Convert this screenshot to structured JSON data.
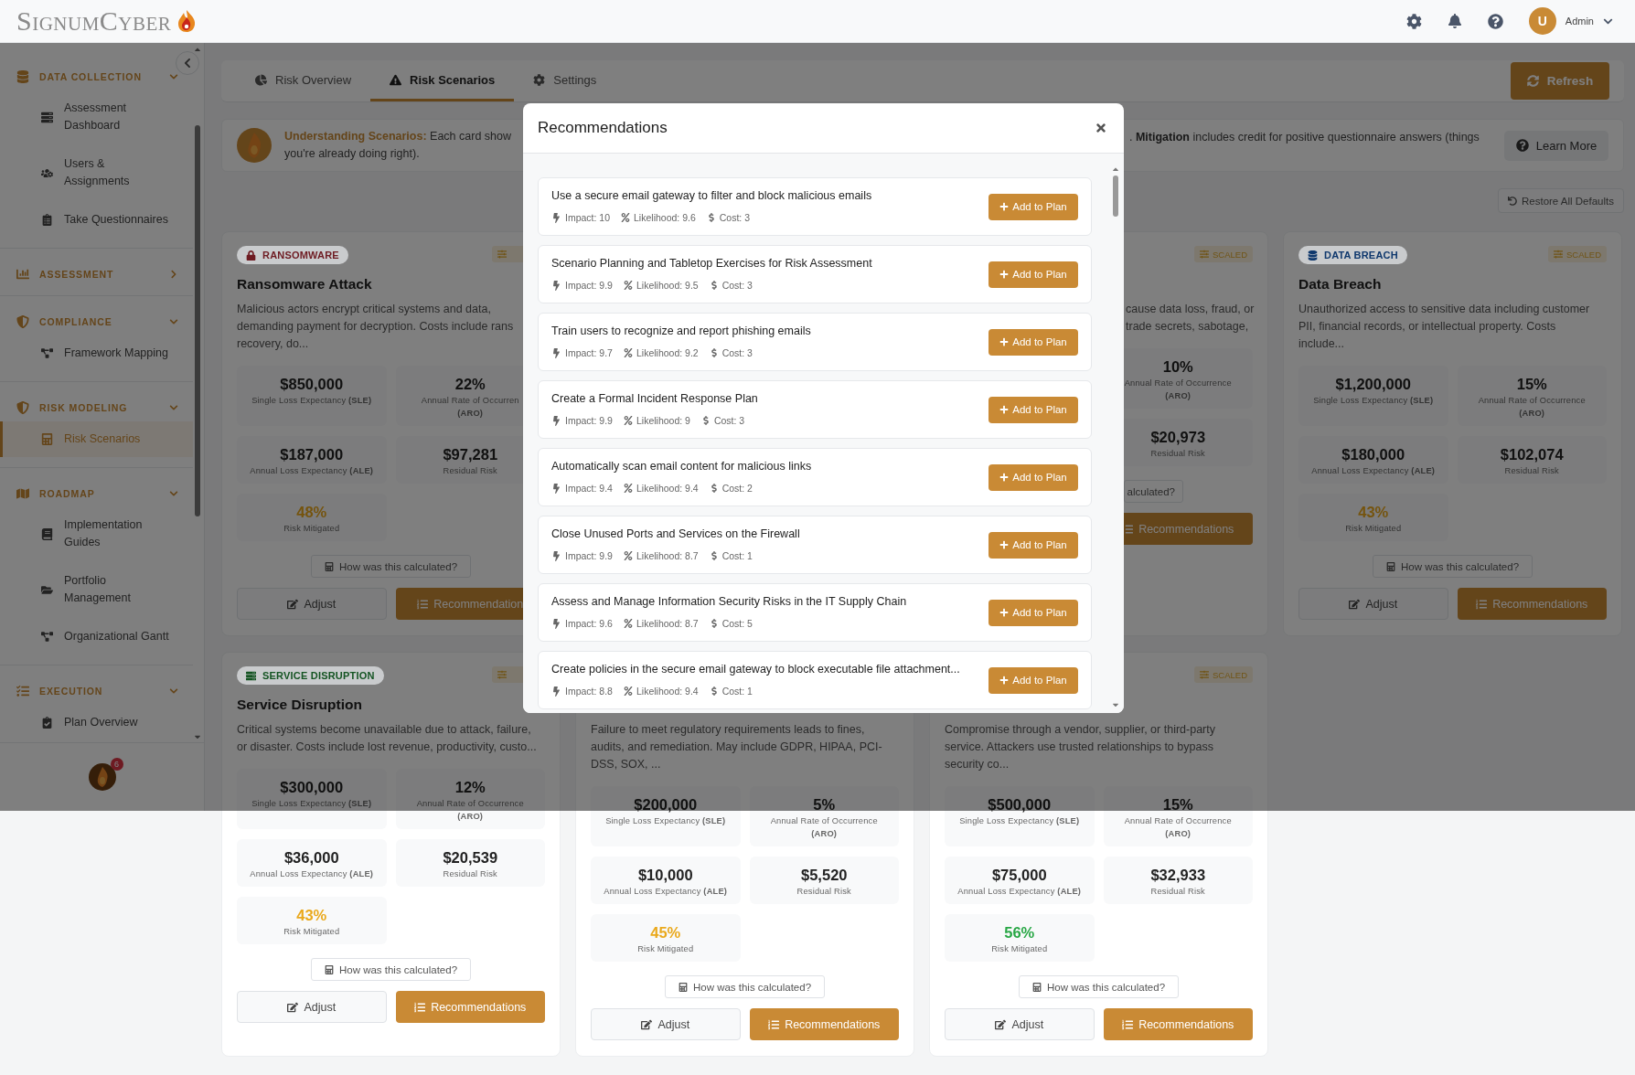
{
  "header": {
    "logo": "SignumCyber",
    "user_initial": "U",
    "user_name": "Admin"
  },
  "sidebar": {
    "sections": [
      {
        "title": "DATA COLLECTION",
        "expanded": true,
        "items": [
          {
            "label": "Assessment Dashboard",
            "selected": false
          },
          {
            "label": "Users & Assignments",
            "selected": false
          },
          {
            "label": "Take Questionnaires",
            "selected": false
          }
        ]
      },
      {
        "title": "ASSESSMENT",
        "expanded": false
      },
      {
        "title": "COMPLIANCE",
        "expanded": true,
        "items": [
          {
            "label": "Framework Mapping",
            "selected": false
          }
        ]
      },
      {
        "title": "RISK MODELING",
        "expanded": true,
        "items": [
          {
            "label": "Risk Scenarios",
            "selected": true
          }
        ]
      },
      {
        "title": "ROADMAP",
        "expanded": true,
        "items": [
          {
            "label": "Implementation Guides",
            "selected": false
          },
          {
            "label": "Portfolio Management",
            "selected": false
          },
          {
            "label": "Organizational Gantt",
            "selected": false
          }
        ]
      },
      {
        "title": "EXECUTION",
        "expanded": true,
        "items": [
          {
            "label": "Plan Overview",
            "selected": false
          }
        ]
      }
    ],
    "notification_count": "6"
  },
  "tabs": [
    {
      "label": "Risk Overview",
      "selected": false
    },
    {
      "label": "Risk Scenarios",
      "selected": true
    },
    {
      "label": "Settings",
      "selected": false
    }
  ],
  "refresh_label": "Refresh",
  "banner": {
    "left_lines": [
      "**Understanding Scenarios:** Each card show",
      "you're already doing right)."
    ],
    "right_text": ". **Mitigation** includes credit for positive questionnaire answers (things",
    "button": "Learn More"
  },
  "restore_label": "Restore All Defaults",
  "cards": [
    {
      "kind": "full",
      "tag": {
        "label": "RANSOMWARE",
        "color": "#6e1b22"
      },
      "scaled": true,
      "title": "Ransomware Attack",
      "desc_lines": [
        "Malicious actors encrypt critical systems and data,",
        "demanding payment for decryption. Costs include rans",
        "recovery, do..."
      ],
      "stats": [
        {
          "value": "$850,000",
          "lines": [
            "Single Loss Expectancy **(SLE)**"
          ]
        },
        {
          "value": "22%",
          "lines": [
            "Annual Rate of Occurren",
            "**(ARO)**"
          ]
        },
        {
          "value": "$187,000",
          "lines": [
            "Annual Loss Expectancy **(ALE)**"
          ]
        },
        {
          "value": "$97,281",
          "lines": [
            "Residual Risk"
          ]
        }
      ],
      "mitigated": {
        "value": "48%",
        "label": "Risk Mitigated",
        "color": "#75540e"
      },
      "calc": "How was this calculated?",
      "adjust": "Adjust",
      "recommend": "Recommendation"
    },
    {
      "kind": "covered"
    },
    {
      "kind": "right_part",
      "scaled": true,
      "scaled_label": "SCALED",
      "desc_lines": [
        "cause data loss, fraud, or",
        "trade secrets, sabotage,"
      ],
      "stats": [
        {
          "value": "10%",
          "lines": [
            "Annual Rate of Occurrence",
            "**(ARO)**"
          ]
        },
        {
          "value": "$20,973",
          "lines": [
            "Residual Risk"
          ]
        }
      ],
      "calc": "alculated?",
      "recommend": "Recommendations"
    },
    {
      "kind": "full",
      "tag": {
        "label": "DATA BREACH",
        "color": "#0f386d"
      },
      "scaled": true,
      "scaled_label": "SCALED",
      "title": "Data Breach",
      "desc_lines": [
        "Unauthorized access to sensitive data including customer",
        "PII, financial records, or intellectual property. Costs",
        "include..."
      ],
      "stats": [
        {
          "value": "$1,200,000",
          "lines": [
            "Single Loss Expectancy **(SLE)**"
          ]
        },
        {
          "value": "15%",
          "lines": [
            "Annual Rate of Occurrence",
            "**(ARO)**"
          ]
        },
        {
          "value": "$180,000",
          "lines": [
            "Annual Loss Expectancy **(ALE)**"
          ]
        },
        {
          "value": "$102,074",
          "lines": [
            "Residual Risk"
          ]
        }
      ],
      "mitigated": {
        "value": "43%",
        "label": "Risk Mitigated",
        "color": "#75540e"
      },
      "calc": "How was this calculated?",
      "adjust": "Adjust",
      "recommend": "Recommendations"
    },
    {
      "kind": "full",
      "tag": {
        "label": "SERVICE DISRUPTION",
        "color": "#145422"
      },
      "scaled": true,
      "title": "Service Disruption",
      "desc_lines": [
        "Critical systems become unavailable due to attack, failure,",
        "or disaster. Costs include lost revenue, productivity, custo..."
      ],
      "stats": [
        {
          "value": "$300,000",
          "lines": [
            "Single Loss Expectancy **(SLE)**"
          ]
        },
        {
          "value": "12%",
          "lines": [
            "Annual Rate of Occurrence",
            "**(ARO)**"
          ]
        },
        {
          "value": "$36,000",
          "lines": [
            "Annual Loss Expectancy **(ALE)**"
          ]
        },
        {
          "value": "$20,539",
          "lines": [
            "Residual Risk"
          ]
        }
      ],
      "mitigated": {
        "value": "43%",
        "label": "Risk Mitigated",
        "color": "#eaa91c"
      },
      "calc": "How was this calculated?",
      "adjust": "Adjust",
      "recommend": "Recommendations"
    },
    {
      "kind": "full",
      "desc_lines": [
        "Failure to meet regulatory requirements leads to fines,",
        "audits, and remediation. May include GDPR, HIPAA, PCI-",
        "DSS, SOX, ..."
      ],
      "stats": [
        {
          "value": "$200,000",
          "lines": [
            "Single Loss Expectancy **(SLE)**"
          ]
        },
        {
          "value": "5%",
          "lines": [
            "Annual Rate of Occurrence",
            "**(ARO)**"
          ]
        },
        {
          "value": "$10,000",
          "lines": [
            "Annual Loss Expectancy **(ALE)**"
          ]
        },
        {
          "value": "$5,520",
          "lines": [
            "Residual Risk"
          ]
        }
      ],
      "mitigated": {
        "value": "45%",
        "label": "Risk Mitigated",
        "color": "#eaa91c"
      },
      "calc": "How was this calculated?",
      "adjust": "Adjust",
      "recommend": "Recommendations"
    },
    {
      "kind": "full",
      "scaled": true,
      "scaled_label": "SCALED",
      "desc_lines": [
        "Compromise through a vendor, supplier, or third-party",
        "service. Attackers use trusted relationships to bypass",
        "security co..."
      ],
      "stats": [
        {
          "value": "$500,000",
          "lines": [
            "Single Loss Expectancy **(SLE)**"
          ]
        },
        {
          "value": "15%",
          "lines": [
            "Annual Rate of Occurrence",
            "**(ARO)**"
          ]
        },
        {
          "value": "$75,000",
          "lines": [
            "Annual Loss Expectancy **(ALE)**"
          ]
        },
        {
          "value": "$32,933",
          "lines": [
            "Residual Risk"
          ]
        }
      ],
      "mitigated": {
        "value": "56%",
        "label": "Risk Mitigated",
        "color": "#28a745"
      },
      "calc": "How was this calculated?",
      "adjust": "Adjust",
      "recommend": "Recommendations"
    }
  ],
  "modal": {
    "title": "Recommendations",
    "items": [
      {
        "title": "Use a secure email gateway to filter and block malicious emails",
        "impact": "Impact: 10",
        "likelihood": "Likelihood: 9.6",
        "cost": "Cost: 3",
        "button": "Add to Plan"
      },
      {
        "title": "Scenario Planning and Tabletop Exercises for Risk Assessment",
        "impact": "Impact: 9.9",
        "likelihood": "Likelihood: 9.5",
        "cost": "Cost: 3",
        "button": "Add to Plan"
      },
      {
        "title": "Train users to recognize and report phishing emails",
        "impact": "Impact: 9.7",
        "likelihood": "Likelihood: 9.2",
        "cost": "Cost: 3",
        "button": "Add to Plan"
      },
      {
        "title": "Create a Formal Incident Response Plan",
        "impact": "Impact: 9.9",
        "likelihood": "Likelihood: 9",
        "cost": "Cost: 3",
        "button": "Add to Plan"
      },
      {
        "title": "Automatically scan email content for malicious links",
        "impact": "Impact: 9.4",
        "likelihood": "Likelihood: 9.4",
        "cost": "Cost: 2",
        "button": "Add to Plan"
      },
      {
        "title": "Close Unused Ports and Services on the Firewall",
        "impact": "Impact: 9.9",
        "likelihood": "Likelihood: 8.7",
        "cost": "Cost: 1",
        "button": "Add to Plan"
      },
      {
        "title": "Assess and Manage Information Security Risks in the IT Supply Chain",
        "impact": "Impact: 9.6",
        "likelihood": "Likelihood: 8.7",
        "cost": "Cost: 5",
        "button": "Add to Plan"
      },
      {
        "title": "Create policies in the secure email gateway to block executable file attachment...",
        "impact": "Impact: 8.8",
        "likelihood": "Likelihood: 9.4",
        "cost": "Cost: 1",
        "button": "Add to Plan"
      }
    ]
  }
}
